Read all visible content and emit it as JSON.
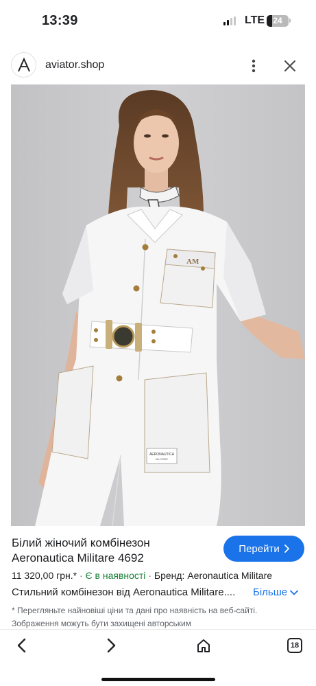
{
  "status_bar": {
    "time": "13:39",
    "network": "LTE",
    "battery": "24",
    "battery_level": 0.24,
    "signal_bars_active": 2,
    "signal_bars_total": 4
  },
  "header": {
    "site": "aviator.shop",
    "logo_icon": "aviator-logo-icon",
    "more_icon": "more-vert-icon",
    "close_icon": "close-icon"
  },
  "image": {
    "label_lines": [
      "AERONAUTICA",
      "MILITARE"
    ]
  },
  "product": {
    "title": "Білий жіночий комбінезон Aeronautica Militare 4692",
    "button_label": "Перейти",
    "price": "11 320,00 грн.*",
    "separator": "·",
    "stock": "Є в наявності",
    "brand": "Бренд: Aeronautica Militare",
    "description": "Стильний комбінезон від Aeronautica Militare....",
    "more_label": "Більше",
    "disclaimer": "* Перегляньте найновіші ціни та дані про наявність на веб-сайті. Зображення можуть бути захищені авторським"
  },
  "bottom_nav": {
    "tabs_count": "18",
    "icons": [
      "back-icon",
      "forward-icon",
      "home-icon",
      "tabs-icon"
    ]
  },
  "colors": {
    "accent": "#1a73e8",
    "stock": "#188038",
    "muted": "#5f6368"
  }
}
